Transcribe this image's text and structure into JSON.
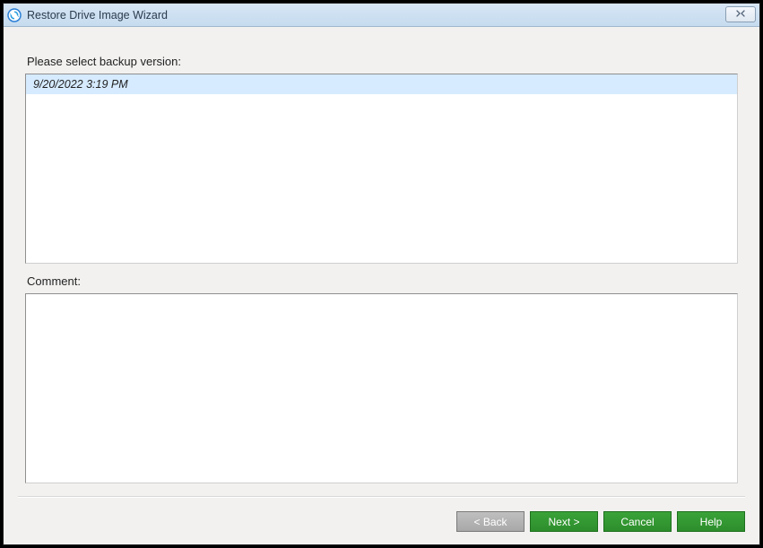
{
  "window": {
    "title": "Restore Drive Image Wizard"
  },
  "labels": {
    "select_backup": "Please select backup version:",
    "comment": "Comment:"
  },
  "backup_versions": [
    {
      "timestamp": "9/20/2022 3:19 PM",
      "selected": true
    }
  ],
  "comment_value": "",
  "buttons": {
    "back": "< Back",
    "next": "Next >",
    "cancel": "Cancel",
    "help": "Help"
  }
}
